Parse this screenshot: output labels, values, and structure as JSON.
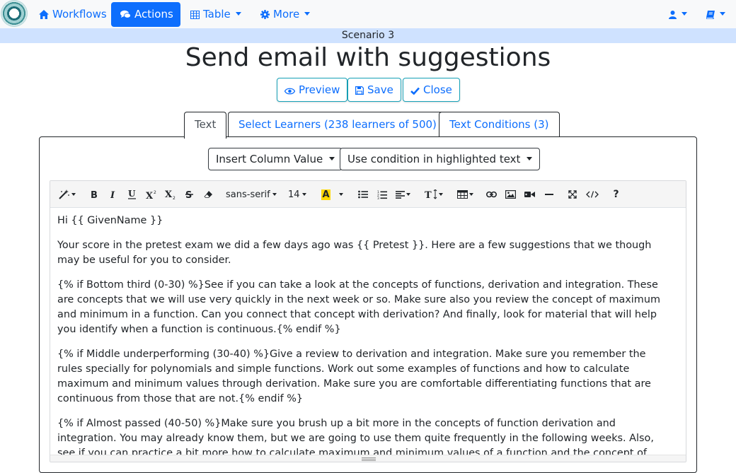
{
  "navbar": {
    "workflows": "Workflows",
    "actions": "Actions",
    "table": "Table",
    "more": "More"
  },
  "scenario": "Scenario 3",
  "page_title": "Send email with suggestions",
  "buttons": {
    "preview": "Preview",
    "save": "Save",
    "close": "Close"
  },
  "tabs": {
    "text": "Text",
    "learners": "Select Learners (238 learners of 500)",
    "conditions": "Text Conditions (3)"
  },
  "panel": {
    "insert_column": "Insert Column Value",
    "use_condition": "Use condition in highlighted text"
  },
  "toolbar": {
    "font_name": "sans-serif",
    "font_size": "14",
    "color_letter": "A",
    "help": "?"
  },
  "content": {
    "p1": "Hi {{ GivenName }}",
    "p2": "Your score in the pretest exam we did a few days ago was {{ Pretest }}. Here are a few suggestions that we though may be useful for you to consider.",
    "p3": "{% if Bottom third (0-30) %}See if you can take a look at the concepts of functions, derivation and integration. These are concepts that we will use very quickly in the next week or so. Make sure also you review the concept of maximum and minimum in a function. Can you connect that concept with derivation? And finally, look for material that will help you identify when a function is continuous.{% endif %}",
    "p4": "{% if Middle underperforming (30-40) %}Give a review to derivation and integration. Make sure you remember the rules specially for polynomials and simple functions. Work out some examples of functions and how to calculate maximum and minimum values through derivation. Make sure you are comfortable differentiating functions that are continuous from those that are not.{% endif %}",
    "p5": "{% if Almost passed (40-50) %}Make sure you brush up a bit more in the concepts of function derivation and integration. You may already know them, but we are going to use them quite frequently in the following weeks. Also, see if you can practice a bit more how to calculate maximum and minimum values of a function and the concept of continuous"
  },
  "colors": {
    "primary": "#0d6efd",
    "scenario_bg": "#cfe2ff",
    "highlight_yellow": "#ffd800"
  }
}
